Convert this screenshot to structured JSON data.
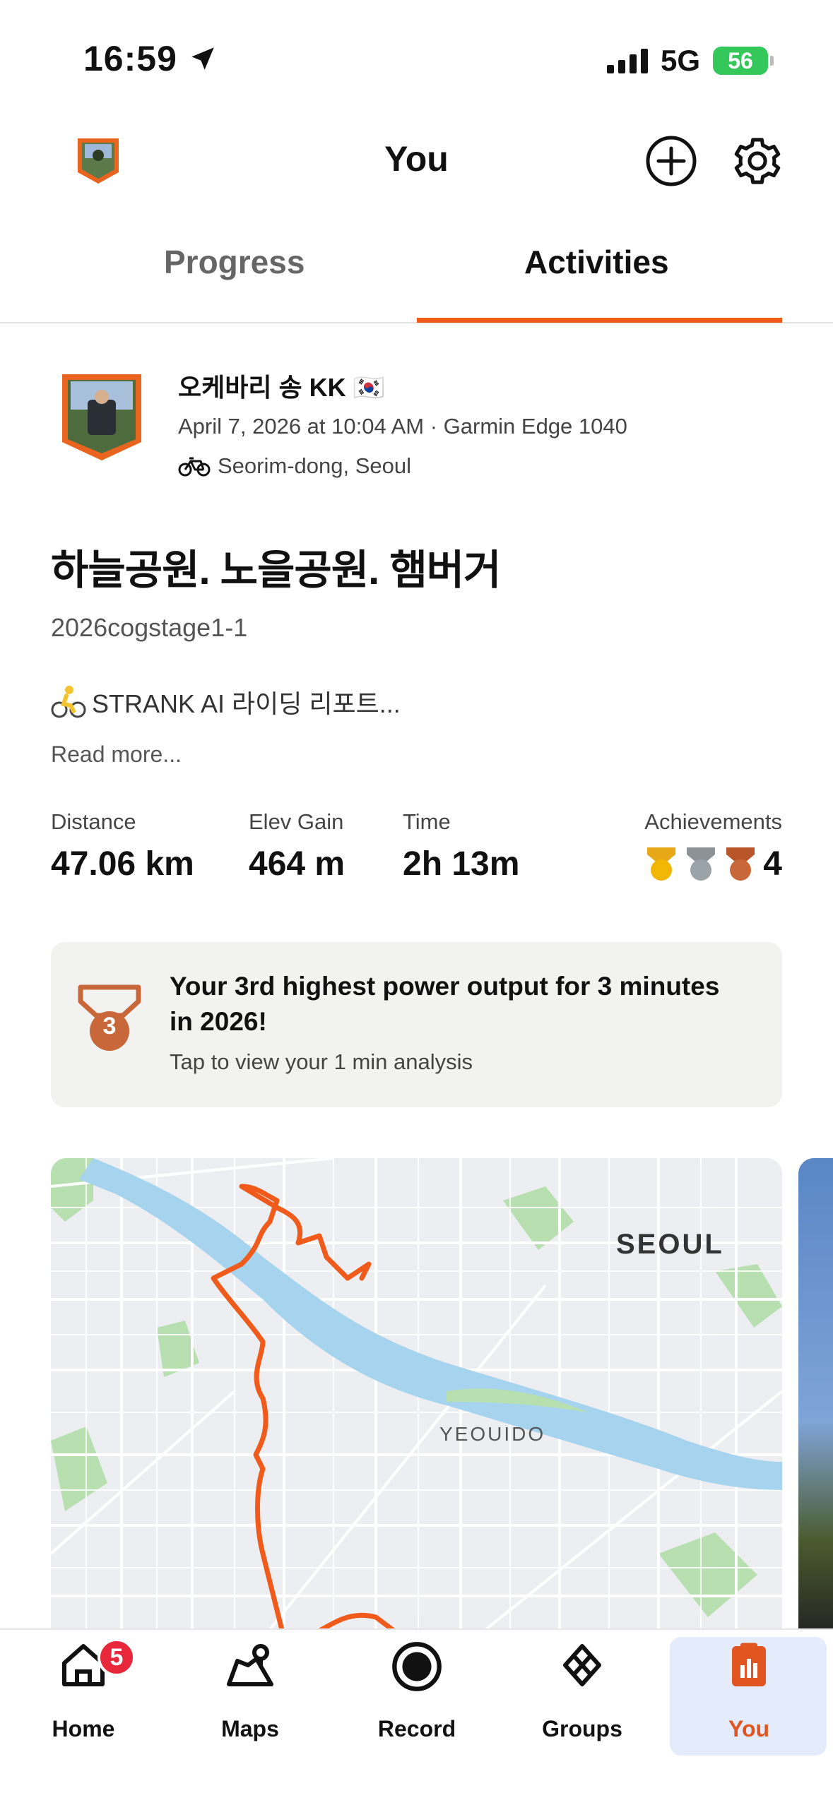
{
  "status": {
    "time": "16:59",
    "network": "5G",
    "battery": "56"
  },
  "header": {
    "title": "You"
  },
  "tabs": [
    {
      "label": "Progress"
    },
    {
      "label": "Activities"
    }
  ],
  "activity": {
    "athlete_name": "오케바리 송 KK 🇰🇷",
    "meta": "April 7, 2026 at 10:04 AM · Garmin Edge 1040",
    "location": "Seorim-dong, Seoul",
    "title": "하늘공원. 노을공원. 햄버거",
    "subtitle": "2026cogstage1-1",
    "description": "STRANK AI 라이딩 리포트...",
    "read_more": "Read more...",
    "stats": [
      {
        "label": "Distance",
        "value": "47.06 km"
      },
      {
        "label": "Elev Gain",
        "value": "464 m"
      },
      {
        "label": "Time",
        "value": "2h 13m"
      },
      {
        "label": "Achievements",
        "value": "4"
      }
    ],
    "achievement_card": {
      "medal_number": "3",
      "title": "Your 3rd highest power output for 3 minutes in 2026!",
      "subtitle": "Tap to view your 1 min analysis"
    },
    "map": {
      "labels": [
        "SEOUL",
        "YEOUIDO"
      ]
    }
  },
  "tabbar": {
    "items": [
      {
        "label": "Home",
        "badge": "5"
      },
      {
        "label": "Maps"
      },
      {
        "label": "Record"
      },
      {
        "label": "Groups"
      },
      {
        "label": "You"
      }
    ]
  },
  "colors": {
    "accent": "#f05a1a",
    "water": "#a6d4ee",
    "park": "#b7dfb0",
    "selected_tab_bg": "#e4ecfb"
  }
}
